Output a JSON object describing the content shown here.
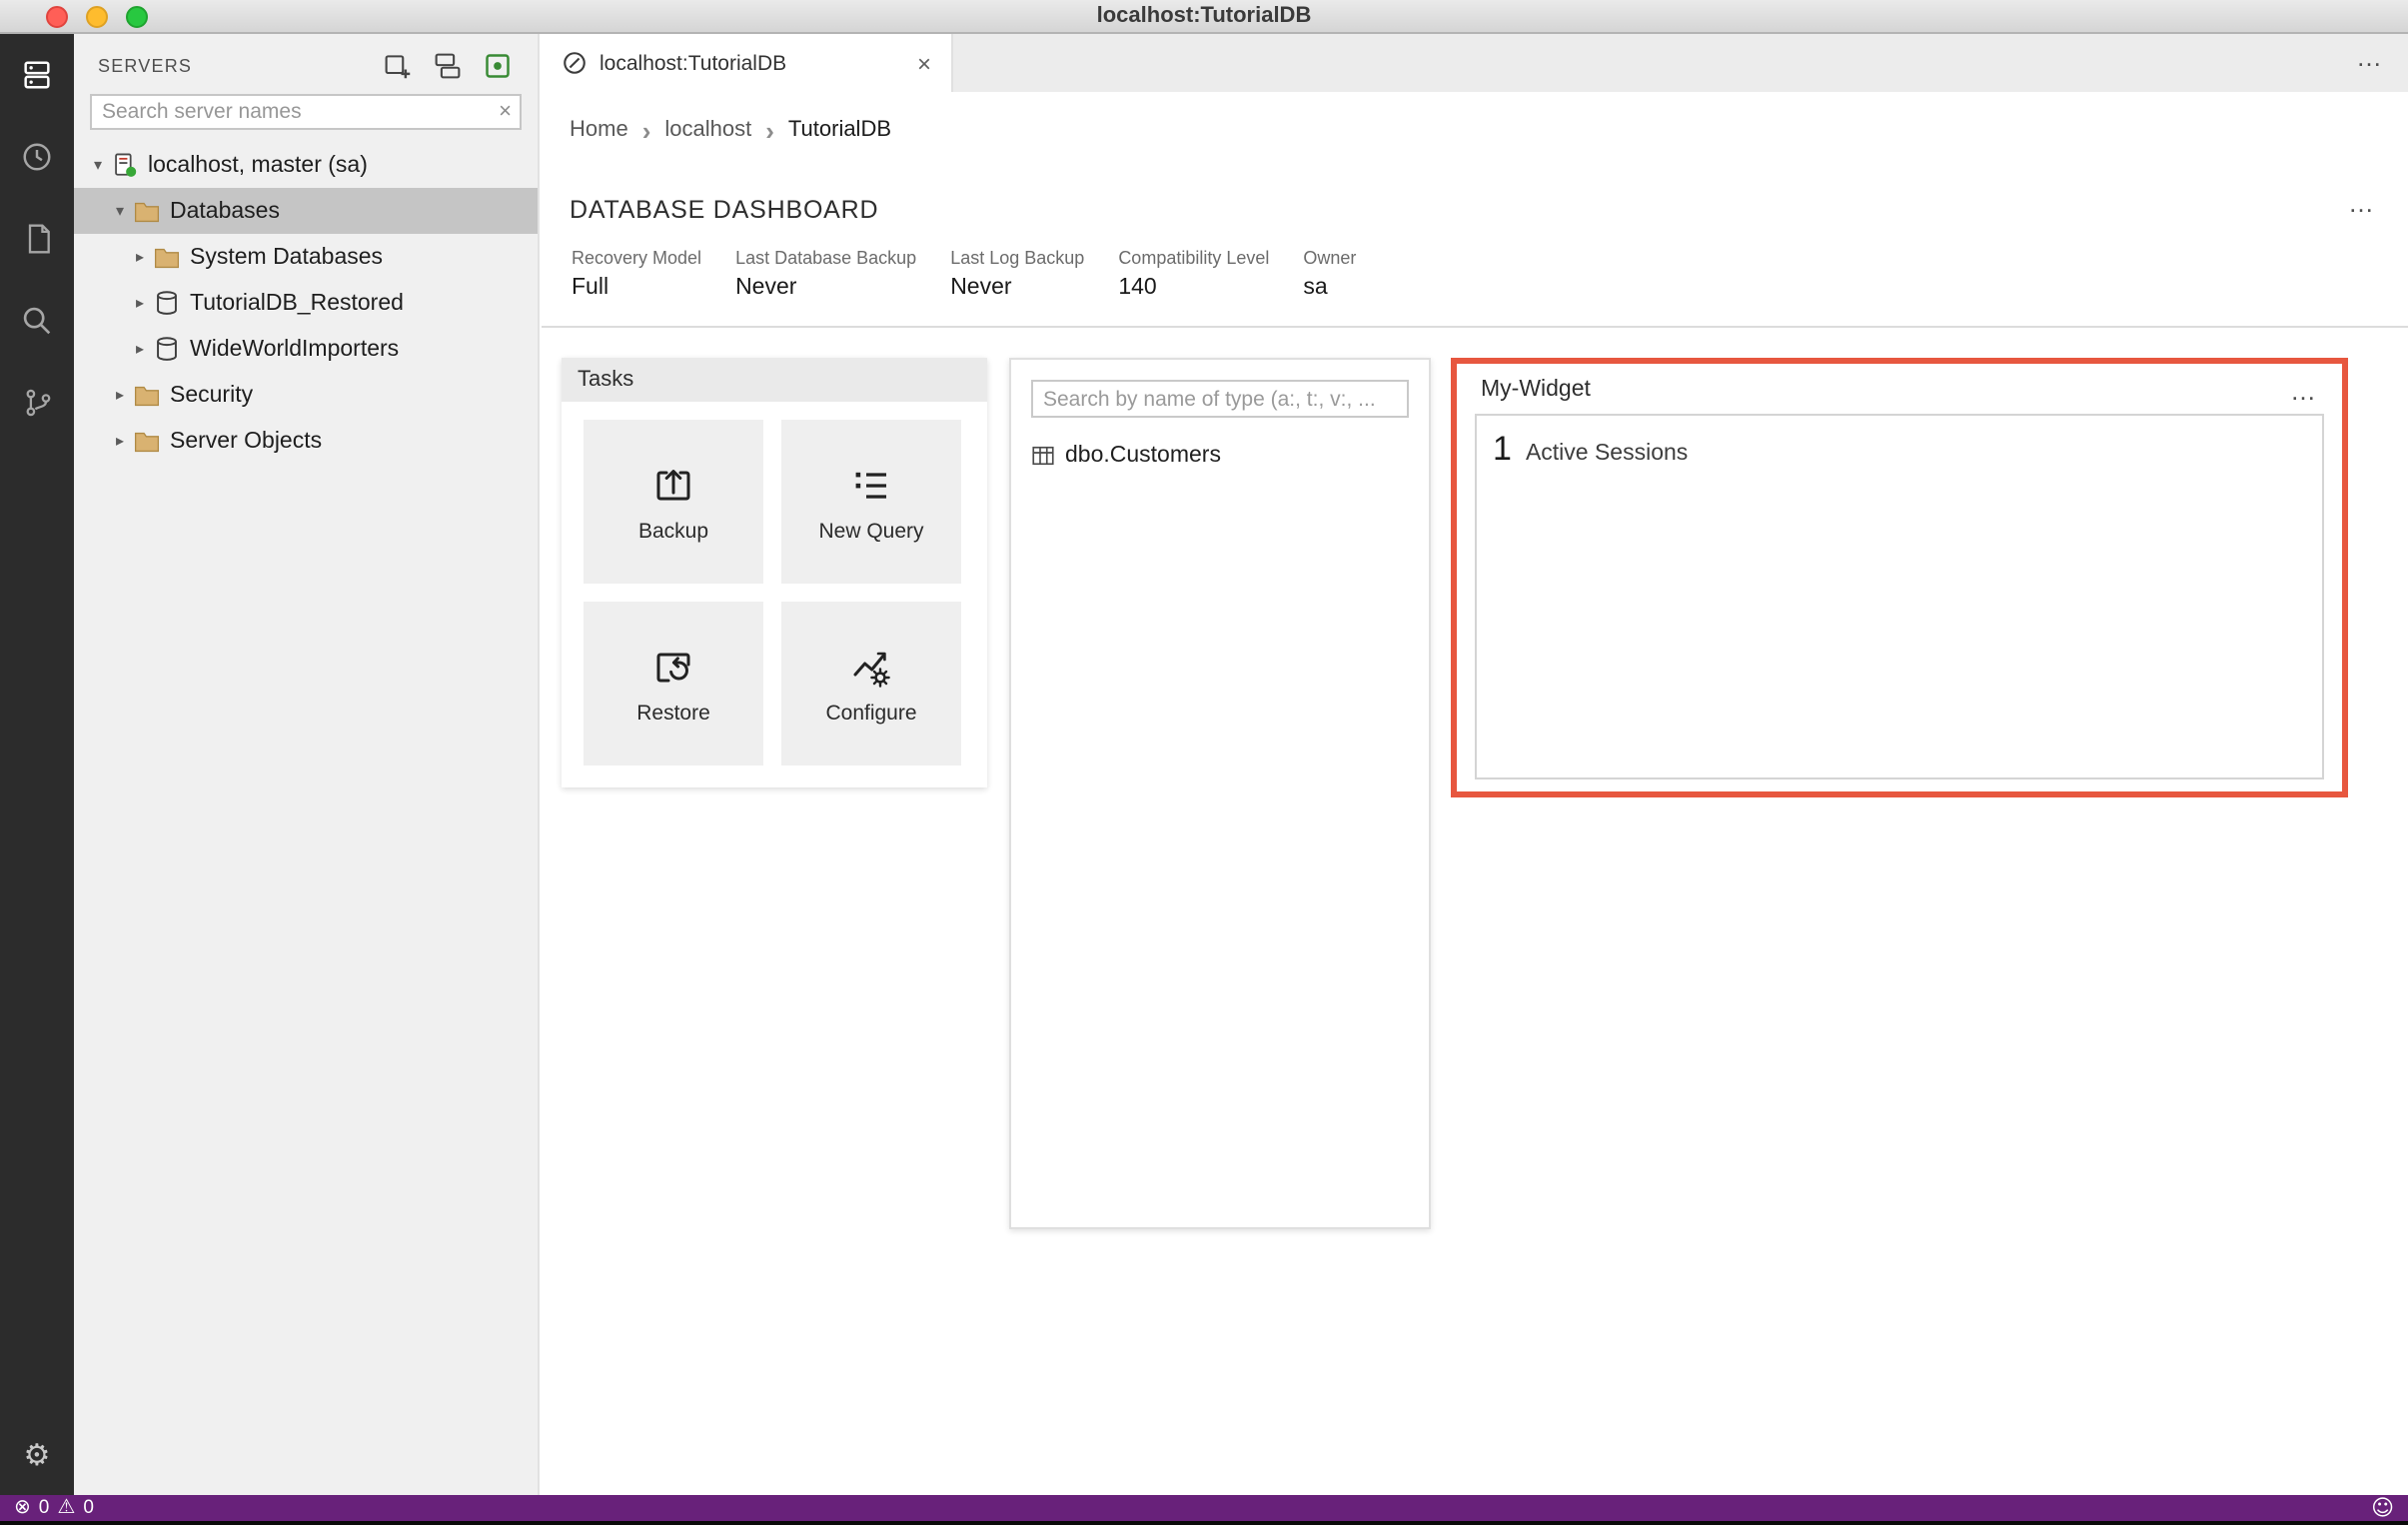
{
  "window": {
    "title": "localhost:TutorialDB"
  },
  "icons": {
    "twisty_expanded": "▾",
    "twisty_collapsed": "▸",
    "more": "…",
    "close": "×",
    "clear": "×",
    "breadcrumb_separator": "›",
    "gear": "⚙",
    "error": "⊗",
    "warning": "⚠",
    "smiley": "☺"
  },
  "sidebar": {
    "title": "SERVERS",
    "search": {
      "placeholder": "Search server names"
    },
    "tree": [
      {
        "label": "localhost, master (sa)",
        "level": 0,
        "expanded": true,
        "icon": "server"
      },
      {
        "label": "Databases",
        "level": 1,
        "expanded": true,
        "icon": "folder",
        "selected": true
      },
      {
        "label": "System Databases",
        "level": 2,
        "expanded": false,
        "icon": "folder"
      },
      {
        "label": "TutorialDB_Restored",
        "level": 2,
        "expanded": false,
        "icon": "database"
      },
      {
        "label": "WideWorldImporters",
        "level": 2,
        "expanded": false,
        "icon": "database"
      },
      {
        "label": "Security",
        "level": 1,
        "expanded": false,
        "icon": "folder"
      },
      {
        "label": "Server Objects",
        "level": 1,
        "expanded": false,
        "icon": "folder"
      }
    ]
  },
  "tab": {
    "label": "localhost:TutorialDB"
  },
  "breadcrumb": {
    "items": [
      "Home",
      "localhost",
      "TutorialDB"
    ]
  },
  "dashboard": {
    "title": "DATABASE DASHBOARD",
    "properties": [
      {
        "label": "Recovery Model",
        "value": "Full"
      },
      {
        "label": "Last Database Backup",
        "value": "Never"
      },
      {
        "label": "Last Log Backup",
        "value": "Never"
      },
      {
        "label": "Compatibility Level",
        "value": "140"
      },
      {
        "label": "Owner",
        "value": "sa"
      }
    ],
    "tasks": {
      "title": "Tasks",
      "buttons": [
        {
          "label": "Backup"
        },
        {
          "label": "New Query"
        },
        {
          "label": "Restore"
        },
        {
          "label": "Configure"
        }
      ]
    },
    "explorer": {
      "search_placeholder": "Search by name of type (a:, t:, v:, ...",
      "items": [
        {
          "label": "dbo.Customers",
          "icon": "table"
        }
      ]
    },
    "my_widget": {
      "title": "My-Widget",
      "count": "1",
      "count_label": "Active Sessions"
    }
  },
  "status_bar": {
    "errors": "0",
    "warnings": "0"
  },
  "colors": {
    "status_bar_bg": "#68217A",
    "highlight_border": "#E7573F",
    "activity_bar_bg": "#2C2C2C",
    "sidebar_bg": "#F0F0F0",
    "selected_row_bg": "#C5C5C5",
    "traffic_red": "#FF5F57",
    "traffic_yellow": "#FEBC2E",
    "traffic_green": "#28C840",
    "folder_icon": "#D9B271"
  }
}
